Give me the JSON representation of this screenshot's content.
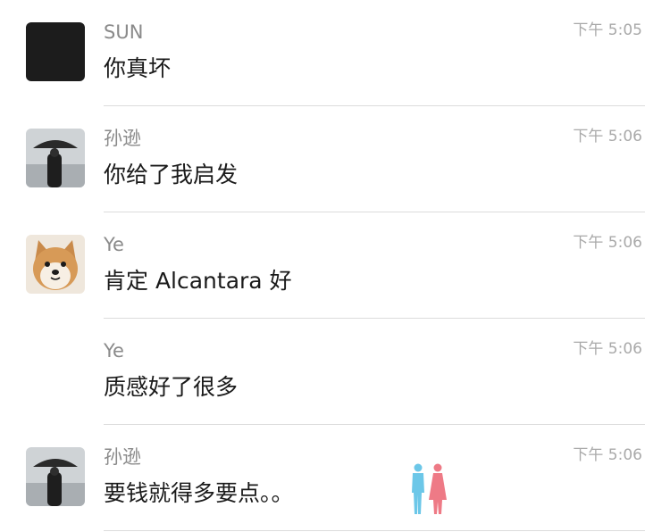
{
  "messages": [
    {
      "sender": "SUN",
      "time": "下午 5:05",
      "text": "你真坏",
      "avatar": "black-square-avatar"
    },
    {
      "sender": "孙逊",
      "time": "下午 5:06",
      "text": "你给了我启发",
      "avatar": "umbrella-person-avatar"
    },
    {
      "sender": "Ye",
      "time": "下午 5:06",
      "text": "肯定 Alcantara 好",
      "avatar": "shiba-dog-avatar"
    },
    {
      "sender": "Ye",
      "time": "下午 5:06",
      "text": "质感好了很多",
      "avatar": ""
    },
    {
      "sender": "孙逊",
      "time": "下午 5:06",
      "text": "要钱就得多要点。。",
      "avatar": "umbrella-person-avatar"
    }
  ],
  "colors": {
    "sender": "#8a8a8a",
    "time": "#a9a9a9",
    "text": "#1a1a1a",
    "divider": "#dcdcdc",
    "watermark_blue": "#6cc7e8",
    "watermark_pink": "#ee7a86"
  }
}
